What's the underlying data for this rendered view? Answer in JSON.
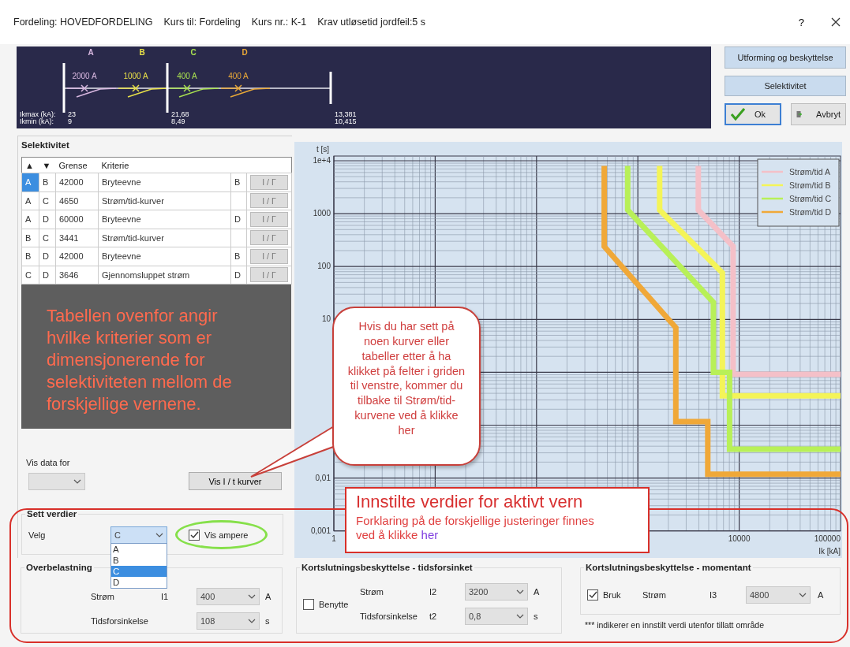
{
  "window": {
    "title_fields": [
      "Fordeling: HOVEDFORDELING",
      "Kurs til: Fordeling",
      "Kurs nr.: K-1",
      "Krav utløsetid jordfeil:5 s"
    ],
    "help": "?"
  },
  "diagram": {
    "breakers": [
      {
        "label": "A",
        "rating": "2000 A",
        "color": "#d8b8e0"
      },
      {
        "label": "B",
        "rating": "1000 A",
        "color": "#e8e048"
      },
      {
        "label": "C",
        "rating": "400 A",
        "color": "#a8e050"
      },
      {
        "label": "D",
        "rating": "400 A",
        "color": "#e8a838"
      }
    ],
    "ik_labels": [
      "Ikmax (kA):",
      "Ikmin (kA):"
    ],
    "buses": [
      {
        "ikmax": "23",
        "ikmin": "9"
      },
      {
        "ikmax": "21,68",
        "ikmin": "8,49"
      },
      {
        "ikmax": "13,381",
        "ikmin": "10,415"
      }
    ]
  },
  "side_buttons": [
    "Utforming og beskyttelse",
    "Selektivitet"
  ],
  "ok_button": "Ok",
  "cancel_button": "Avbryt",
  "selectivity": {
    "title": "Selektivitet",
    "columns": [
      "▲",
      "▼",
      "Grense",
      "Kriterie"
    ],
    "rows": [
      {
        "from": "A",
        "to": "B",
        "limit": "42000",
        "criterion": "Bryteevne",
        "breaker": "B",
        "button": "I / Γ",
        "selected": true
      },
      {
        "from": "A",
        "to": "C",
        "limit": "4650",
        "criterion": "Strøm/tid-kurver",
        "button": "I / Γ",
        "selected": false
      },
      {
        "from": "A",
        "to": "D",
        "limit": "60000",
        "criterion": "Bryteevne",
        "breaker": "D",
        "button": "I / Γ",
        "selected": false
      },
      {
        "from": "B",
        "to": "C",
        "limit": "3441",
        "criterion": "Strøm/tid-kurver",
        "button": "I / Γ",
        "selected": false
      },
      {
        "from": "B",
        "to": "D",
        "limit": "42000",
        "criterion": "Bryteevne",
        "breaker": "B",
        "button": "I / Γ",
        "selected": false
      },
      {
        "from": "C",
        "to": "D",
        "limit": "3646",
        "criterion": "Gjennomsluppet strøm",
        "breaker": "D",
        "button": "I / Γ",
        "selected": false
      }
    ],
    "note": "Tabellen ovenfor angir hvilke kriterier som er dimensjonerende for selektiviteten mellom de forskjellige vernene."
  },
  "show_data_for": {
    "label": "Vis data for"
  },
  "curves_button": "Vis I / t kurver",
  "settings": {
    "title": "Sett verdier",
    "select_label": "Velg",
    "select_value": "C",
    "options": [
      {
        "label": "A",
        "selected": false
      },
      {
        "label": "B",
        "selected": false
      },
      {
        "label": "C",
        "selected": true
      },
      {
        "label": "D",
        "selected": false
      }
    ],
    "show_amps": {
      "label": "Vis ampere",
      "checked": true
    }
  },
  "overload": {
    "title": "Overbelastning",
    "rows": [
      {
        "label": "Strøm",
        "symbol": "I1",
        "value": "400",
        "unit": "A"
      },
      {
        "label": "Tidsforsinkelse",
        "value": "108",
        "unit": "s"
      }
    ]
  },
  "short_delay": {
    "title": "Kortslutningsbeskyttelse - tidsforsinket",
    "enable": {
      "label": "Benytte",
      "checked": false
    },
    "rows": [
      {
        "label": "Strøm",
        "symbol": "I2",
        "value": "3200",
        "unit": "A"
      },
      {
        "label": "Tidsforsinkelse",
        "symbol": "t2",
        "value": "0,8",
        "unit": "s"
      }
    ]
  },
  "instantaneous": {
    "title": "Kortslutningsbeskyttelse - momentant",
    "enable": {
      "label": "Bruk",
      "checked": true
    },
    "label": "Strøm",
    "symbol": "I3",
    "value": "4800",
    "unit": "A"
  },
  "footnote": "*** indikerer en innstilt verdi utenfor tillatt område",
  "chart": {
    "ylabel": "t [s]",
    "xlabel": "Ik [kA]",
    "y_tick_labels": [
      "1e+4",
      "1000",
      "100",
      "10",
      "0,01",
      "0,001"
    ],
    "x_tick_labels": [
      "1",
      "10000",
      "100000"
    ],
    "legend": [
      {
        "label": "Strøm/tid A",
        "color": "#f4c0c8"
      },
      {
        "label": "Strøm/tid B",
        "color": "#f4f458"
      },
      {
        "label": "Strøm/tid C",
        "color": "#b8f058"
      },
      {
        "label": "Strøm/tid D",
        "color": "#f0a838"
      }
    ]
  },
  "annotations": {
    "callout": "Hvis du har sett på noen kurver eller tabeller etter å ha klikket på felter i griden til venstre, kommer du tilbake til Strøm/tid-kurvene ved å klikke her",
    "settings_box": {
      "title": "Innstilte verdier for aktivt vern",
      "text": "Forklaring på de forskjellige justeringer finnes ved å klikke",
      "link": "her"
    }
  }
}
